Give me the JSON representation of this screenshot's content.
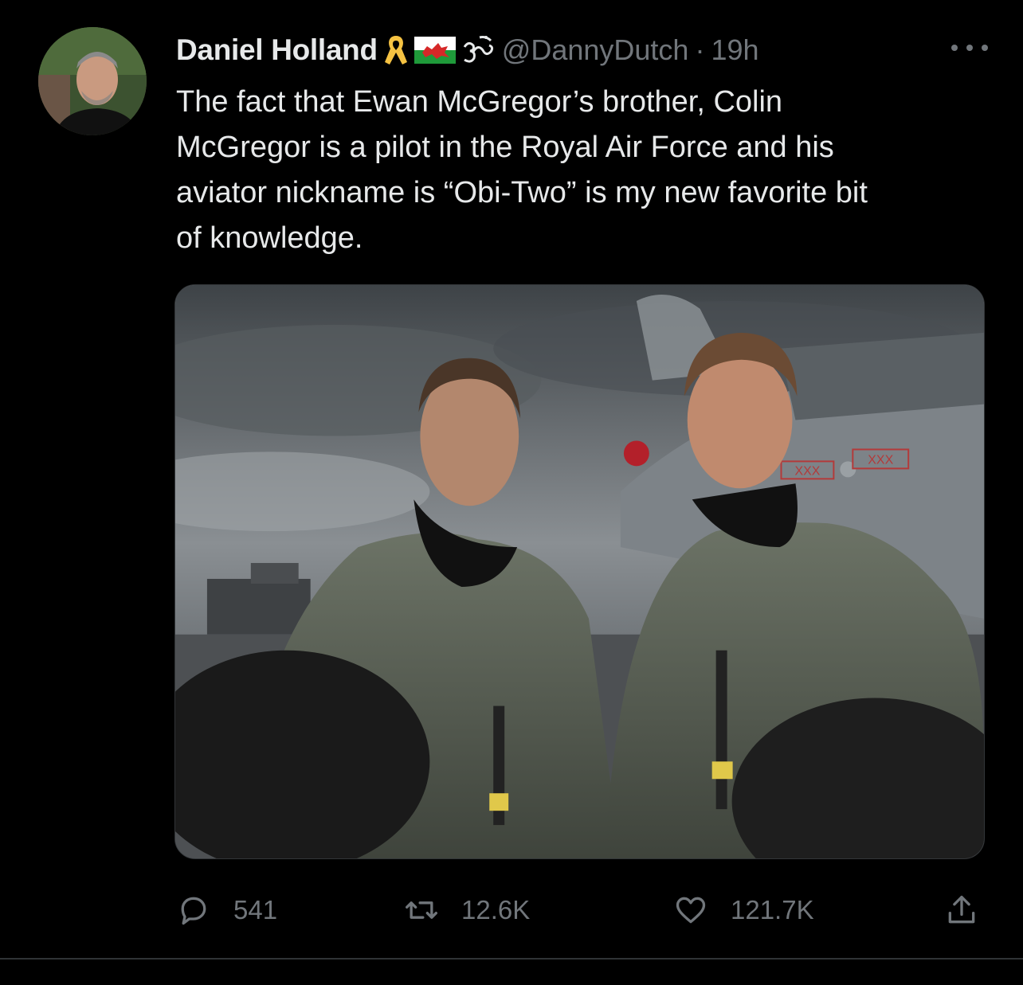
{
  "author": {
    "name": "Daniel Holland",
    "handle": "@DannyDutch",
    "separator": "·",
    "time": "19h",
    "emojis": [
      "ribbon-icon",
      "wales-flag-icon",
      "om-icon"
    ]
  },
  "tweet": {
    "text": "The fact that Ewan McGregor’s brother, Colin\nMcGregor is a pilot in the Royal Air Force and his\naviator nickname is “Obi-Two” is my new favorite bit\nof knowledge."
  },
  "media": {
    "aircraft_markings": [
      "XXX",
      "XXX"
    ]
  },
  "actions": {
    "replies": "541",
    "retweets": "12.6K",
    "likes": "121.7K"
  },
  "colors": {
    "background": "#000000",
    "text_primary": "#e7e9ea",
    "text_secondary": "#71767b",
    "divider": "#2f3336",
    "ribbon": "#f5c242"
  }
}
